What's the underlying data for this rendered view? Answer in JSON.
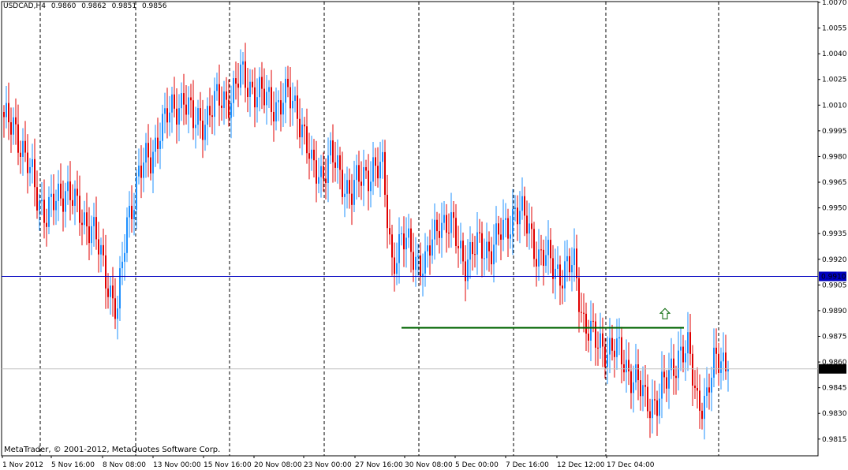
{
  "header": {
    "symbol": "USDCAD,H4",
    "open": "0.9860",
    "high": "0.9862",
    "low": "0.9851",
    "close": "0.9856"
  },
  "copyright": "MetaTrader, © 2001-2012, MetaQuotes Software Corp.",
  "colors": {
    "background": "#ffffff",
    "bull": "#1e90ff",
    "bear": "#e00000",
    "grid": "#000000",
    "hline": "#0000c0",
    "resistance": "#006400",
    "price_line": "#c0c0c0"
  },
  "icons": {
    "arrow": "up-arrow-icon"
  },
  "chart_data": {
    "type": "candlestick",
    "symbol": "USDCAD",
    "timeframe": "H4",
    "ylim": [
      0.9808,
      1.007
    ],
    "y_ticks": [
      "1.0070",
      "1.0055",
      "1.0040",
      "1.0025",
      "1.0010",
      "0.9995",
      "0.9980",
      "0.9965",
      "0.9950",
      "0.9935",
      "0.9920",
      "0.9905",
      "0.9890",
      "0.9875",
      "0.9860",
      "0.9845",
      "0.9830",
      "0.9815"
    ],
    "x_ticks": [
      "1 Nov 2012",
      "5 Nov 16:00",
      "8 Nov 08:00",
      "13 Nov 00:00",
      "15 Nov 16:00",
      "20 Nov 08:00",
      "23 Nov 00:00",
      "27 Nov 16:00",
      "30 Nov 08:00",
      "5 Dec 00:00",
      "7 Dec 16:00",
      "12 Dec 12:00",
      "17 Dec 04:00"
    ],
    "horizontal_line": {
      "price": 0.991,
      "label": "0.9910"
    },
    "current_price": {
      "price": 0.9856,
      "label": "0.9856"
    },
    "resistance_line": {
      "price": 0.988,
      "from_candle": 168,
      "to_candle": 214
    },
    "arrow_marker": {
      "price": 0.9888,
      "candle": 210,
      "direction": "up"
    },
    "grid": "vertical dashed",
    "anchors": [
      [
        0,
        0.9998
      ],
      [
        4,
        1.0003
      ],
      [
        9,
        0.9975
      ],
      [
        12,
        0.9969
      ],
      [
        18,
        0.9943
      ],
      [
        23,
        0.9958
      ],
      [
        26,
        0.9962
      ],
      [
        31,
        0.9948
      ],
      [
        37,
        0.994
      ],
      [
        42,
        0.9915
      ],
      [
        48,
        0.989
      ],
      [
        52,
        0.994
      ],
      [
        57,
        0.9972
      ],
      [
        62,
        0.9977
      ],
      [
        66,
        0.9999
      ],
      [
        72,
        1.0006
      ],
      [
        76,
        1.0017
      ],
      [
        80,
        0.9998
      ],
      [
        84,
        1.0002
      ],
      [
        89,
        1.001
      ],
      [
        96,
        1.0016
      ],
      [
        100,
        1.0026
      ],
      [
        105,
        1.0021
      ],
      [
        110,
        1.0013
      ],
      [
        116,
        1.0011
      ],
      [
        120,
        1.0014
      ],
      [
        124,
        1.0009
      ],
      [
        127,
        0.9992
      ],
      [
        130,
        0.9972
      ],
      [
        134,
        0.9971
      ],
      [
        138,
        0.998
      ],
      [
        142,
        0.9968
      ],
      [
        147,
        0.996
      ],
      [
        151,
        0.9966
      ],
      [
        156,
        0.9975
      ],
      [
        160,
        0.997
      ],
      [
        164,
        0.992
      ],
      [
        168,
        0.993
      ],
      [
        172,
        0.9926
      ],
      [
        178,
        0.9915
      ],
      [
        184,
        0.9945
      ],
      [
        190,
        0.9935
      ],
      [
        195,
        0.992
      ],
      [
        201,
        0.9927
      ],
      [
        207,
        0.9928
      ],
      [
        212,
        0.9938
      ],
      [
        216,
        0.995
      ],
      [
        222,
        0.9938
      ],
      [
        226,
        0.9922
      ],
      [
        231,
        0.9918
      ],
      [
        236,
        0.9912
      ],
      [
        241,
        0.9916
      ],
      [
        245,
        0.9885
      ],
      [
        250,
        0.987
      ],
      [
        254,
        0.987
      ],
      [
        258,
        0.9867
      ],
      [
        263,
        0.9858
      ],
      [
        267,
        0.985
      ],
      [
        271,
        0.9836
      ],
      [
        276,
        0.9838
      ],
      [
        280,
        0.9848
      ],
      [
        285,
        0.9866
      ],
      [
        289,
        0.9865
      ],
      [
        293,
        0.9839
      ],
      [
        297,
        0.9838
      ],
      [
        300,
        0.9857
      ],
      [
        303,
        0.9865
      ],
      [
        305,
        0.986
      ],
      [
        306,
        0.9856
      ]
    ]
  }
}
